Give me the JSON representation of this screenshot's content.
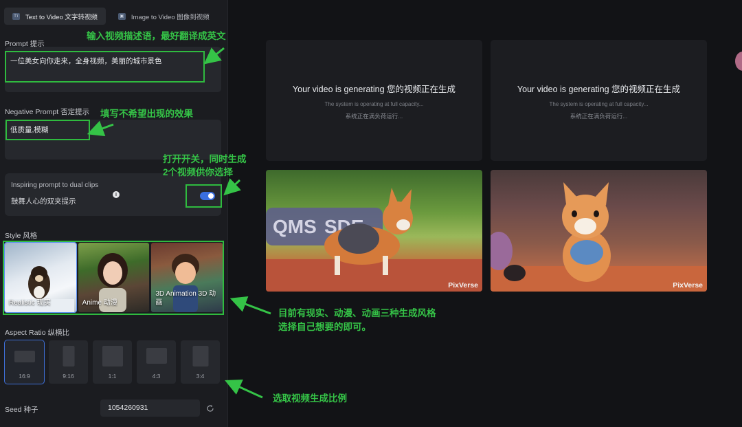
{
  "tabs": [
    {
      "label": "Text to Video 文字转视频",
      "active": true
    },
    {
      "label": "Image to Video 图像到视频",
      "active": false
    }
  ],
  "prompt": {
    "label": "Prompt 提示",
    "value": "一位美女向你走来，全身视频，美丽的城市景色"
  },
  "negative_prompt": {
    "label": "Negative Prompt 否定提示",
    "value": "低质量,模糊"
  },
  "dual_clips": {
    "label_en": "Inspiring prompt to dual clips",
    "label_cn": "鼓舞人心的双夹提示",
    "enabled": true
  },
  "style": {
    "label": "Style 风格",
    "options": [
      {
        "name": "Realistic 现实",
        "selected": true
      },
      {
        "name": "Anime 动漫",
        "selected": false
      },
      {
        "name": "3D Animation 3D 动画",
        "selected": false
      }
    ]
  },
  "aspect_ratio": {
    "label": "Aspect Ratio 纵横比",
    "options": [
      "16:9",
      "9:16",
      "1:1",
      "4:3",
      "3:4"
    ],
    "selected": "16:9"
  },
  "seed": {
    "label": "Seed 种子",
    "value": "1054260931"
  },
  "generating": {
    "title": "Your video is generating 您的视频正在生成",
    "subtitle": "The system is operating at full capacity...",
    "subtitle_cn": "系统正在满负荷运行..."
  },
  "videos": [
    {
      "watermark": "PixVerse"
    },
    {
      "watermark": "PixVerse"
    }
  ],
  "annotations": {
    "prompt_tip": "输入视频描述语，最好翻译成英文",
    "negative_tip": "填写不希望出现的效果",
    "dual_tip_1": "打开开关，同时生成",
    "dual_tip_2": "2个视频供你选择",
    "style_tip_1": "目前有现实、动漫、动画三种生成风格",
    "style_tip_2": "选择自己想要的即可。",
    "ratio_tip": "选取视频生成比例"
  },
  "colors": {
    "annotation_green": "#35c347",
    "toggle_blue": "#3a6fe0",
    "selected_outline": "#5b8ef0"
  }
}
